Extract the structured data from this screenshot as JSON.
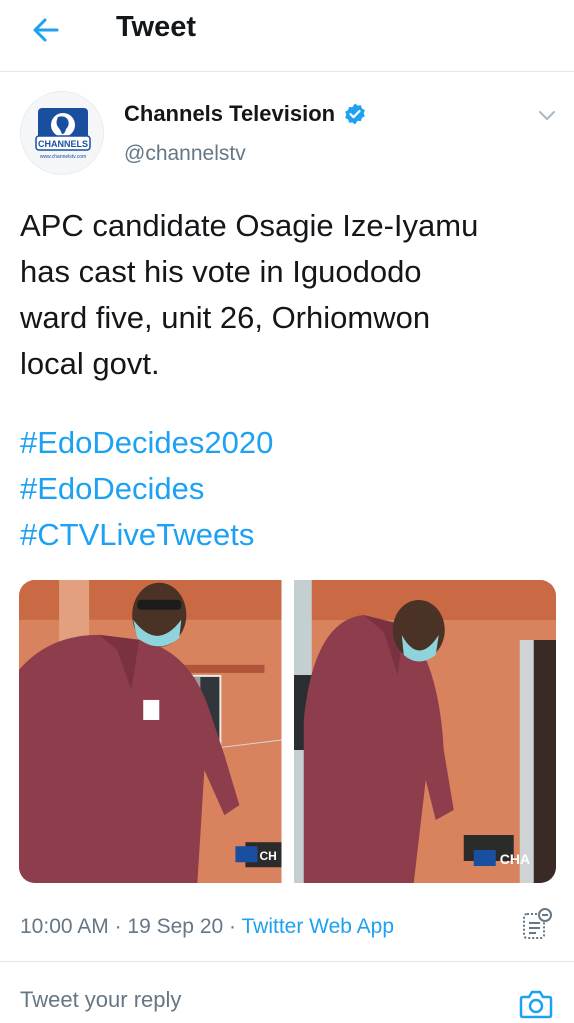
{
  "header": {
    "title": "Tweet",
    "back_icon": "arrow-left-icon"
  },
  "author": {
    "name": "Channels Television",
    "handle": "@channelstv",
    "verified": true,
    "avatar_text": "CHANNELS",
    "avatar_url_text": "www.channelstv.com"
  },
  "tweet": {
    "text_lines": [
      "APC candidate Osagie Ize-Iyamu",
      "has cast his vote in Iguododo",
      "ward five, unit 26, Orhiomwon",
      "local govt."
    ],
    "hashtags": [
      "#EdoDecides2020",
      "#EdoDecides",
      "#CTVLiveTweets"
    ],
    "media": [
      {
        "watermark": "CH"
      },
      {
        "watermark": "CHA"
      }
    ],
    "time": "10:00 AM",
    "separator": "·",
    "date": "19 Sep 20",
    "source": "Twitter Web App"
  },
  "reply": {
    "placeholder": "Tweet your reply"
  },
  "colors": {
    "accent": "#1da1f2",
    "text": "#14171a",
    "secondary": "#657786",
    "divider": "#e1e8ed"
  }
}
